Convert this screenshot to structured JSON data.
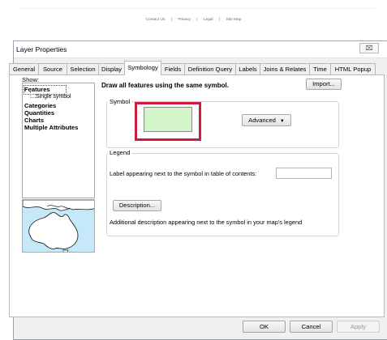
{
  "page_links": [
    "Contact Us",
    "Privacy",
    "Legal",
    "Site Map"
  ],
  "page_links_sep": "|",
  "dialog": {
    "title": "Layer Properties",
    "close_glyph": "⌧"
  },
  "tabs": [
    {
      "label": "General"
    },
    {
      "label": "Source"
    },
    {
      "label": "Selection"
    },
    {
      "label": "Display"
    },
    {
      "label": "Symbology",
      "active": true
    },
    {
      "label": "Fields"
    },
    {
      "label": "Definition Query"
    },
    {
      "label": "Labels"
    },
    {
      "label": "Joins & Relates"
    },
    {
      "label": "Time"
    },
    {
      "label": "HTML Popup"
    }
  ],
  "show": {
    "label": "Show:",
    "items": [
      "Features",
      "Categories",
      "Quantities",
      "Charts",
      "Multiple Attributes"
    ],
    "sub_item": "Single symbol"
  },
  "symbology": {
    "heading": "Draw all features using the same symbol.",
    "import_label": "Import...",
    "symbol_group": "Symbol",
    "advanced_label": "Advanced",
    "symbol_color": "#d4f5ca",
    "highlight_color": "#cc1e3c",
    "legend_group": "Legend",
    "legend_label_text": "Label appearing next to the symbol in table of contents:",
    "legend_label_value": "",
    "description_button": "Description...",
    "description_text": "Additional description appearing next to the symbol in your map's legend"
  },
  "buttons": {
    "ok": "OK",
    "cancel": "Cancel",
    "apply": "Apply"
  }
}
